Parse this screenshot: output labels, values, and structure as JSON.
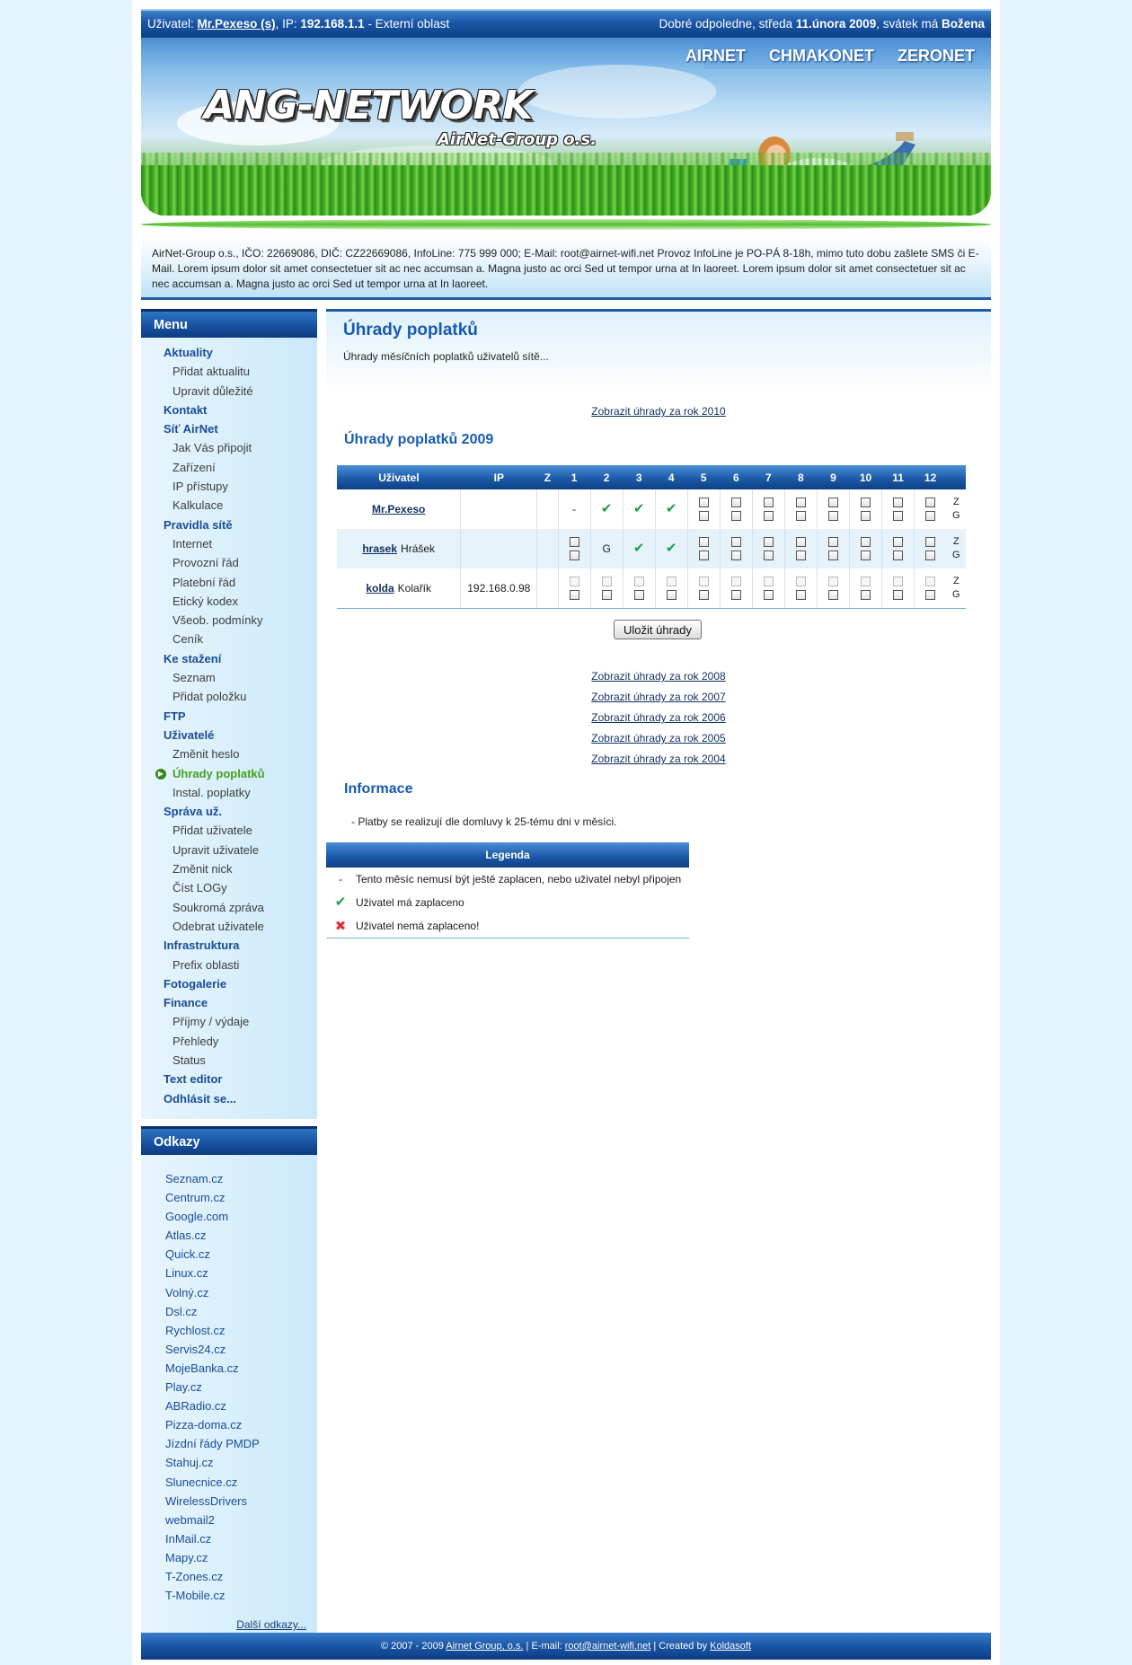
{
  "topbar": {
    "user_label": "Uživatel:",
    "user_name": "Mr.Pexeso (s)",
    "ip_label": ", IP:",
    "ip": "192.168.1.1",
    "area": " - Externí oblast",
    "greeting": "Dobré odpoledne, středa ",
    "date": "11.února 2009",
    "nameday_label": ", svátek má ",
    "nameday": "Božena"
  },
  "banner": {
    "logo": "ANG-NETWORK",
    "logo_sub": "AirNet-Group o.s.",
    "nav": [
      "AIRNET",
      "CHMAKONET",
      "ZERONET"
    ]
  },
  "infobox": {
    "text": "AirNet-Group o.s., IČO: 22669086, DIČ: CZ22669086, InfoLine: 775 999 000; E-Mail: root@airnet-wifi.net Provoz InfoLine je PO-PÁ 8-18h, mimo tuto dobu zašlete SMS či E-Mail. Lorem ipsum dolor sit amet consectetuer sit ac nec accumsan a. Magna justo ac orci Sed ut tempor urna at In laoreet. Lorem ipsum dolor sit amet consectetuer sit ac nec accumsan a. Magna justo ac orci Sed ut tempor urna at In laoreet."
  },
  "menu": {
    "title": "Menu",
    "items": [
      {
        "label": "Aktuality",
        "level": 1
      },
      {
        "label": "Přidat aktualitu",
        "level": 2
      },
      {
        "label": "Upravit důležité",
        "level": 2
      },
      {
        "label": "Kontakt",
        "level": 1
      },
      {
        "label": "Síť AirNet",
        "level": 1
      },
      {
        "label": "Jak Vás připojit",
        "level": 2
      },
      {
        "label": "Zařízení",
        "level": 2
      },
      {
        "label": "IP přístupy",
        "level": 2
      },
      {
        "label": "Kalkulace",
        "level": 2
      },
      {
        "label": "Pravidla sítě",
        "level": 1
      },
      {
        "label": "Internet",
        "level": 2
      },
      {
        "label": "Provozní řád",
        "level": 2
      },
      {
        "label": "Platební řád",
        "level": 2
      },
      {
        "label": "Etický kodex",
        "level": 2
      },
      {
        "label": "Všeob. podmínky",
        "level": 2
      },
      {
        "label": "Ceník",
        "level": 2
      },
      {
        "label": "Ke stažení",
        "level": 1
      },
      {
        "label": "Seznam",
        "level": 2
      },
      {
        "label": "Přidat položku",
        "level": 2
      },
      {
        "label": "FTP",
        "level": 1
      },
      {
        "label": "Uživatelé",
        "level": 1
      },
      {
        "label": "Změnit heslo",
        "level": 2
      },
      {
        "label": "Úhrady poplatků",
        "level": 2,
        "active": true
      },
      {
        "label": "Instal. poplatky",
        "level": 2
      },
      {
        "label": "Správa už.",
        "level": 1
      },
      {
        "label": "Přidat uživatele",
        "level": 2
      },
      {
        "label": "Upravit uživatele",
        "level": 2
      },
      {
        "label": "Změnit nick",
        "level": 2
      },
      {
        "label": "Číst LOGy",
        "level": 2
      },
      {
        "label": "Soukromá zpráva",
        "level": 2
      },
      {
        "label": "Odebrat uživatele",
        "level": 2
      },
      {
        "label": "Infrastruktura",
        "level": 1
      },
      {
        "label": "Prefix oblasti",
        "level": 2
      },
      {
        "label": "Fotogalerie",
        "level": 1
      },
      {
        "label": "Finance",
        "level": 1
      },
      {
        "label": "Příjmy / výdaje",
        "level": 2
      },
      {
        "label": "Přehledy",
        "level": 2
      },
      {
        "label": "Status",
        "level": 2
      },
      {
        "label": "Text editor",
        "level": 1
      },
      {
        "label": "Odhlásit se...",
        "level": 1
      }
    ]
  },
  "links": {
    "title": "Odkazy",
    "items": [
      "Seznam.cz",
      "Centrum.cz",
      "Google.com",
      "Atlas.cz",
      "Quick.cz",
      "Linux.cz",
      "Volný.cz",
      "Dsl.cz",
      "Rychlost.cz",
      "Servis24.cz",
      "MojeBanka.cz",
      "Play.cz",
      "ABRadio.cz",
      "Pizza-doma.cz",
      "Jízdní řády PMDP",
      "Stahuj.cz",
      "Slunecnice.cz",
      "WirelessDrivers",
      "webmail2",
      "InMail.cz",
      "Mapy.cz",
      "T-Zones.cz",
      "T-Mobile.cz"
    ],
    "more": "Další odkazy..."
  },
  "main": {
    "title": "Úhrady poplatků",
    "subtitle": "Úhrady měsíčních poplatků uživatelů sítě...",
    "link_2010": "Zobrazit úhrady za rok 2010",
    "section_title": "Úhrady poplatků 2009",
    "table": {
      "headers": [
        "Uživatel",
        "IP",
        "Z",
        "1",
        "2",
        "3",
        "4",
        "5",
        "6",
        "7",
        "8",
        "9",
        "10",
        "11",
        "12"
      ],
      "rows": [
        {
          "login": "Mr.Pexeso",
          "name": "",
          "ip": "",
          "shaded": false,
          "months": [
            "-",
            "ok",
            "ok",
            "ok",
            "cb2",
            "cb2",
            "cb2",
            "cb2",
            "cb2",
            "cb2",
            "cb2",
            "cb2"
          ],
          "z": "Z",
          "g": "G"
        },
        {
          "login": "hrasek",
          "name": "Hrášek",
          "ip": "",
          "shaded": true,
          "months": [
            "cb2",
            "G",
            "ok",
            "ok",
            "cb2",
            "cb2",
            "cb2",
            "cb2",
            "cb2",
            "cb2",
            "cb2",
            "cb2"
          ],
          "z": "Z",
          "g": "G"
        },
        {
          "login": "kolda",
          "name": "Kolařík",
          "ip": "192.168.0.98",
          "shaded": false,
          "months": [
            "dcb",
            "dcb",
            "dcb",
            "dcb",
            "dcb",
            "dcb",
            "dcb",
            "dcb",
            "dcb",
            "dcb",
            "dcb",
            "dcb"
          ],
          "z": "Z",
          "g": "G"
        }
      ]
    },
    "save_label": "Uložit úhrady",
    "year_links": [
      "Zobrazit úhrady za rok 2008",
      "Zobrazit úhrady za rok 2007",
      "Zobrazit úhrady za rok 2006",
      "Zobrazit úhrady za rok 2005",
      "Zobrazit úhrady za rok 2004"
    ],
    "info_title": "Informace",
    "info_text": "- Platby se realizují dle domluvy k 25-tému dni v měsíci.",
    "legend": {
      "title": "Legenda",
      "items": [
        {
          "symbol": "-",
          "text": "Tento měsíc nemusí být ještě zaplacen, nebo uživatel nebyl připojen"
        },
        {
          "symbol": "check-icon",
          "text": "Uživatel má zaplaceno"
        },
        {
          "symbol": "cross-icon",
          "text": "Uživatel nemá zaplaceno!"
        }
      ]
    }
  },
  "footer": {
    "copy": "© 2007 - 2009 ",
    "org": "Airnet Group, o.s.",
    "email_label": " | E-mail: ",
    "email": "root@airnet-wifi.net",
    "created_label": " | Created by ",
    "author": "Koldasoft"
  },
  "colors": {
    "accent": "#175bb0",
    "header_blue": "#1a56a6",
    "active_green": "#46a01c",
    "ok_green": "#1ea04a",
    "error_red": "#e0303a"
  }
}
